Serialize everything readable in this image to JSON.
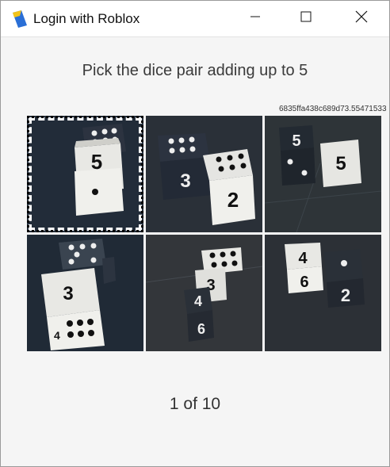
{
  "window": {
    "title": "Login with Roblox"
  },
  "icons": {
    "app": "roblox-app-icon",
    "minimize": "minimize-icon",
    "maximize": "maximize-icon",
    "close": "close-icon"
  },
  "challenge": {
    "prompt": "Pick the dice pair adding up to 5",
    "id": "6835ffa438c689d73.55471533",
    "counter": "1 of 10",
    "selected_index": 0,
    "tiles": [
      {
        "position": 1,
        "dice": "5 and 6 pips"
      },
      {
        "position": 2,
        "dice": "6 pips, 3 and 2"
      },
      {
        "position": 3,
        "dice": "5, 2 pips and 5"
      },
      {
        "position": 4,
        "dice": "5 pips, 3 and 6 pips"
      },
      {
        "position": 5,
        "dice": "6 pips, 3, 4 and 6"
      },
      {
        "position": 6,
        "dice": "4, 6, 1 pip and 2"
      }
    ]
  },
  "colors": {
    "background": "#f5f5f5",
    "titlebar": "#ffffff",
    "text": "#3a3a3a"
  }
}
